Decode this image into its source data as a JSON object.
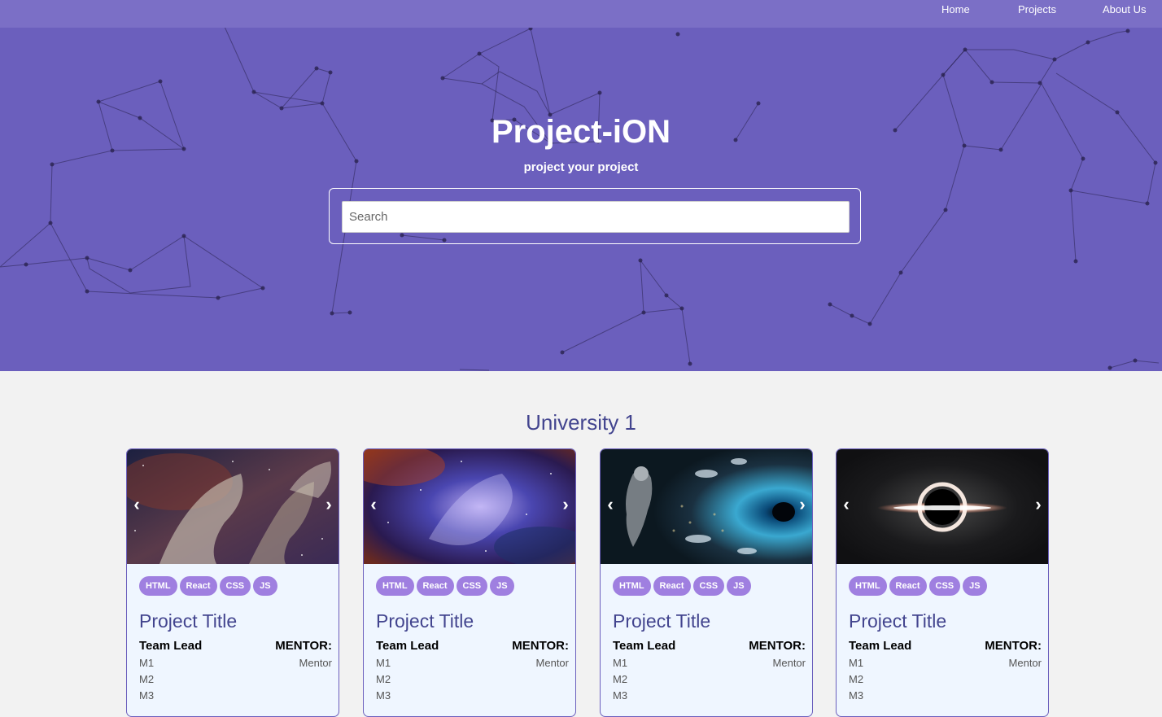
{
  "colors": {
    "hero_bg": "#6b5fbd",
    "navbar_bg": "#7b6fc6",
    "accent": "#43458f",
    "tag_bg": "#9f7fe0",
    "card_bg": "#eff6ff"
  },
  "nav": {
    "items": [
      {
        "label": "Home"
      },
      {
        "label": "Projects"
      },
      {
        "label": "About Us"
      }
    ]
  },
  "hero": {
    "title": "Project-iON",
    "tagline": "project your project",
    "search_placeholder": "Search"
  },
  "section": {
    "title": "University 1"
  },
  "cards": [
    {
      "image": "pillars-nebula-image",
      "prev": "‹",
      "next": "›",
      "tags": [
        "HTML",
        "React",
        "CSS",
        "JS"
      ],
      "title": "Project Title",
      "team_lead": "Team Lead",
      "mentor_label": "MENTOR:",
      "mentor": "Mentor",
      "members": [
        "M1",
        "M2",
        "M3"
      ]
    },
    {
      "image": "purple-nebula-image",
      "prev": "‹",
      "next": "›",
      "tags": [
        "HTML",
        "React",
        "CSS",
        "JS"
      ],
      "title": "Project Title",
      "team_lead": "Team Lead",
      "mentor_label": "MENTOR:",
      "mentor": "Mentor",
      "members": [
        "M1",
        "M2",
        "M3"
      ]
    },
    {
      "image": "astronaut-wormhole-image",
      "prev": "‹",
      "next": "›",
      "tags": [
        "HTML",
        "React",
        "CSS",
        "JS"
      ],
      "title": "Project Title",
      "team_lead": "Team Lead",
      "mentor_label": "MENTOR:",
      "mentor": "Mentor",
      "members": [
        "M1",
        "M2",
        "M3"
      ]
    },
    {
      "image": "black-hole-image",
      "prev": "‹",
      "next": "›",
      "tags": [
        "HTML",
        "React",
        "CSS",
        "JS"
      ],
      "title": "Project Title",
      "team_lead": "Team Lead",
      "mentor_label": "MENTOR:",
      "mentor": "Mentor",
      "members": [
        "M1",
        "M2",
        "M3"
      ]
    }
  ]
}
